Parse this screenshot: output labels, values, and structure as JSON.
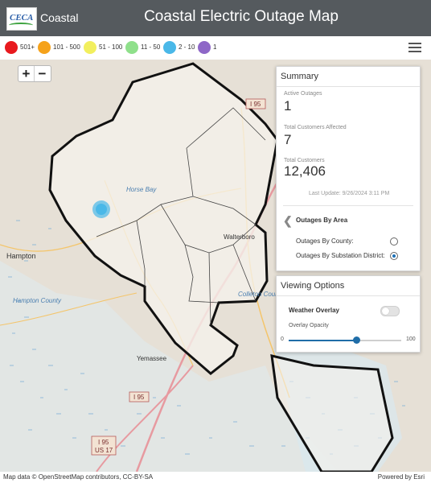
{
  "header": {
    "logo_text": "CECA",
    "brand": "Coastal",
    "title": "Coastal Electric Outage Map"
  },
  "legend": [
    {
      "label": "501+",
      "color": "#e8191e"
    },
    {
      "label": "101 - 500",
      "color": "#f5a21b"
    },
    {
      "label": "51 - 100",
      "color": "#f2ef5e"
    },
    {
      "label": "11 - 50",
      "color": "#8fe08b"
    },
    {
      "label": "2 - 10",
      "color": "#4ab8e8"
    },
    {
      "label": "1",
      "color": "#8e67c7"
    }
  ],
  "menu_icon": "hamburger-icon",
  "zoom": {
    "in": "+",
    "out": "−"
  },
  "map_labels": {
    "horse_bay": "Horse Bay",
    "walterboro": "Walterboro",
    "hampton": "Hampton",
    "hampton_county": "Hampton County",
    "colleton_county": "Colleton County",
    "yemassee": "Yemassee",
    "i95_a": "I 95",
    "i95_b": "I 95",
    "i95_c": "I 95",
    "us17": "US 17"
  },
  "summary": {
    "title": "Summary",
    "active_outages_label": "Active Outages",
    "active_outages": "1",
    "customers_affected_label": "Total Customers Affected",
    "customers_affected": "7",
    "total_customers_label": "Total Customers",
    "total_customers": "12,406",
    "last_update": "Last Update: 9/26/2024 3:11 PM",
    "area_title": "Outages By Area",
    "by_county": "Outages By County:",
    "by_substation": "Outages By Substation District:",
    "selected": "substation"
  },
  "viewing_options": {
    "title": "Viewing Options",
    "weather_overlay": "Weather Overlay",
    "weather_on": false,
    "overlay_opacity": "Overlay Opacity",
    "slider_min": "0",
    "slider_max": "100",
    "slider_value": 0.6
  },
  "footer": {
    "attribution": "Map data © OpenStreetMap contributors, CC-BY-SA",
    "powered": "Powered by Esri"
  },
  "colors": {
    "header_bg": "#555a5e",
    "outage_marker": "#4ab8e8",
    "slider_fill": "#1f6da8"
  }
}
